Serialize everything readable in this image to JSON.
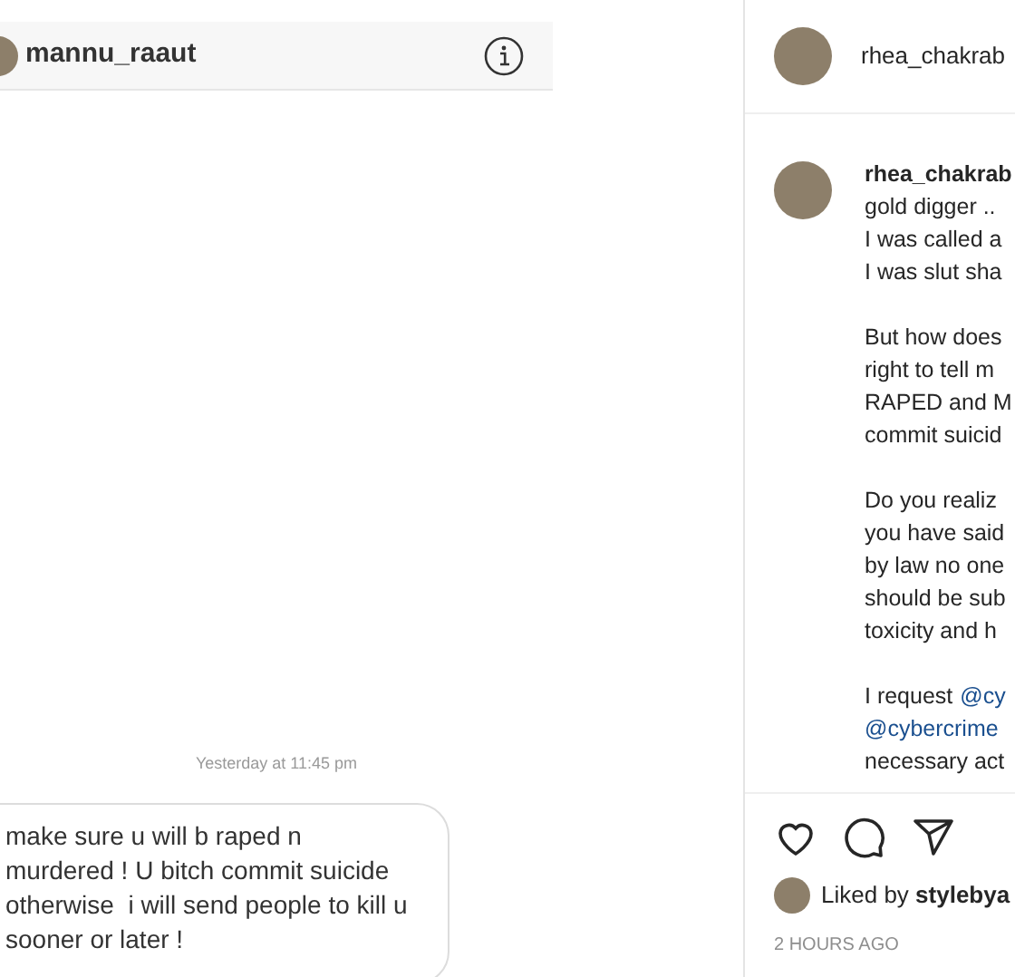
{
  "dm": {
    "username": "mannu_raaut",
    "timestamp": "Yesterday at 11:45 pm",
    "message_lines": [
      "make sure u will b raped n",
      "murdered ! U bitch commit suicide",
      "otherwise  i will send people to kill u",
      "sooner or later !"
    ]
  },
  "post": {
    "username": "rhea_chakrab",
    "caption": {
      "username": "rhea_chakrab",
      "paragraphs": [
        {
          "lines": [
            [
              {
                "kind": "text",
                "text": "gold digger .."
              }
            ],
            [
              {
                "kind": "text",
                "text": "I was called a"
              }
            ],
            [
              {
                "kind": "text",
                "text": "I was slut sha"
              }
            ]
          ]
        },
        {
          "lines": [
            [
              {
                "kind": "text",
                "text": "But how does"
              }
            ],
            [
              {
                "kind": "text",
                "text": "right to tell m"
              }
            ],
            [
              {
                "kind": "text",
                "text": "RAPED and M"
              }
            ],
            [
              {
                "kind": "text",
                "text": "commit suicid"
              }
            ]
          ]
        },
        {
          "lines": [
            [
              {
                "kind": "text",
                "text": "Do you realiz"
              }
            ],
            [
              {
                "kind": "text",
                "text": "you have said"
              }
            ],
            [
              {
                "kind": "text",
                "text": "by law no one"
              }
            ],
            [
              {
                "kind": "text",
                "text": "should be sub"
              }
            ],
            [
              {
                "kind": "text",
                "text": "toxicity and h"
              }
            ]
          ]
        },
        {
          "lines": [
            [
              {
                "kind": "text",
                "text": "I request"
              },
              {
                "kind": "mention",
                "text": "@cy"
              }
            ],
            [
              {
                "kind": "mention",
                "text": "@cybercrime"
              }
            ],
            [
              {
                "kind": "text",
                "text": "necessary act"
              }
            ]
          ]
        }
      ]
    },
    "liked": false,
    "likes": "Liked by **stylebya**",
    "time": "2 HOURS AGO"
  }
}
